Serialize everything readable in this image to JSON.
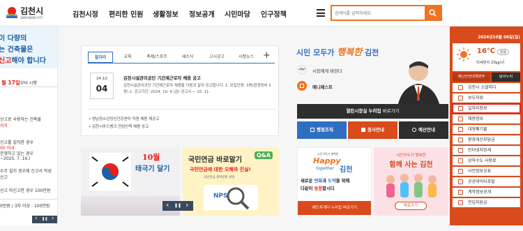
{
  "header": {
    "logo_text": "김천시",
    "logo_sub": "GIMCHEON CITY",
    "nav": [
      "김천시정",
      "편리한 민원",
      "생활정보",
      "정보공개",
      "시민마당",
      "인구정책"
    ],
    "search_placeholder": "검색어를 입력하세요."
  },
  "left_banner": {
    "line1": "이 다량의",
    "line2": "는 건축물은",
    "line3_a": "신고",
    "line3_b": "해야 합니다",
    "date_a": "월 17일",
    "date_b": "부터 시행",
    "t1": "신고로 사용하는 건축물",
    "t2": "리자",
    "t3": "신고를 설치한 경우",
    "t4": "00 이내",
    "t5": "운영하고 있는 경우",
    "t6": "~2025. 7. 16.)",
    "t7": "수조 설치 경우에 신고서 작성",
    "t8": "신고",
    "t9": "신고 미신고한 경우 100만원",
    "t10": "0만원 / 3차 이상 - 100만원"
  },
  "tabs": [
    "알자리",
    "교육",
    "축제/스포츠",
    "새소식",
    "고시공고",
    "시정뉴스"
  ],
  "tab_plus": "+",
  "featured": {
    "date_ym": "24.10",
    "date_d": "04",
    "title": "김천시설관리공단 기간제근로자 채용 공고",
    "desc": "김천시설관리공단 기간제근로자 채용을 다음과 같이 공고합니다. 1. 모집인원: 3명(환경정비 3명) 2. 공고기간: 2024. 10. 4.(금) 공고시 ~ 10. 11."
  },
  "list_items": [
    "영남청소년정신건강센터 직원 채용 재공고",
    "김천시푸드뱅크 전담인력 채용 공고"
  ],
  "center": {
    "slogan_a": "시민 모두가",
    "slogan_b": "행복한",
    "slogan_c": "김천",
    "menu1": "시장에게 바란다",
    "menu2": "매니페스토",
    "live": "열린시장실 누리집",
    "live_suffix": " 바로가기",
    "btn1": "행정조직",
    "btn2": "청사안내",
    "btn3": "예산안내"
  },
  "banner1": {
    "a": "10월",
    "b": "태극기 달기"
  },
  "banner2": {
    "title": "국민연금 바로알기",
    "qa": "Q&A",
    "sub": "국민연금에 대한 오해와 진실!",
    "small": "국민연금 개혁방향 설명",
    "logo": "NPS"
  },
  "pager": {
    "prev": "‹",
    "pause": "❚❚",
    "next": "›"
  },
  "banner3": {
    "top": "시민 모두가 행복한",
    "happy": "Happy",
    "together": "together",
    "city": "김천",
    "line1_a": "새로운 ",
    "line1_b": "변화",
    "line1_c": "과 ",
    "line1_d": "도약",
    "line1_e": "을 위해",
    "line2_a": "다같이 ",
    "line2_b": "동참",
    "line2_c": "합시다",
    "btn": "애드투게더 누리집 바로가기"
  },
  "banner4": {
    "small": "시민모두가 행복한",
    "title": "함께 사는 김천",
    "btn": "바로가기"
  },
  "left_pager": {
    "prev": "‹",
    "pause": "❚❚",
    "next": "›"
  },
  "sidebar": {
    "date": "2024년10월 06일(일)",
    "temp": "16℃",
    "weather": "맑음",
    "dust": "미세먼지 20㎍/㎥",
    "tab1": "재난안전대책본부",
    "tab2": "날씨누리",
    "items": [
      "김천시 소셜미디",
      "보도자료",
      "일자리정보",
      "채용정보",
      "대형폐기물",
      "환경개선부담금",
      "인터넷지방세",
      "상하수도 사용료",
      "사전정보공표",
      "공공데이터포털",
      "계약정보공개",
      "전입지원금"
    ]
  },
  "colors": {
    "accent": "#ee7322",
    "sidebar": "#d94a1c",
    "blue": "#2f6fc2",
    "highlight": "#e8211c"
  }
}
